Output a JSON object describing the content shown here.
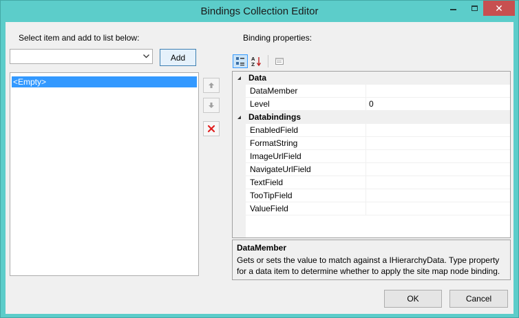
{
  "window": {
    "title": "Bindings Collection Editor",
    "close_glyph": "✕"
  },
  "left": {
    "label": "Select item and add to list below:",
    "combo_value": "",
    "add_label": "Add",
    "items": [
      "<Empty>"
    ]
  },
  "right": {
    "label": "Binding properties:"
  },
  "grid": {
    "categories": [
      {
        "name": "Data",
        "properties": [
          {
            "name": "DataMember",
            "value": ""
          },
          {
            "name": "Level",
            "value": "0"
          }
        ]
      },
      {
        "name": "Databindings",
        "properties": [
          {
            "name": "EnabledField",
            "value": ""
          },
          {
            "name": "FormatString",
            "value": ""
          },
          {
            "name": "ImageUrlField",
            "value": ""
          },
          {
            "name": "NavigateUrlField",
            "value": ""
          },
          {
            "name": "TextField",
            "value": ""
          },
          {
            "name": "TooTipField",
            "value": ""
          },
          {
            "name": "ValueField",
            "value": ""
          }
        ]
      }
    ]
  },
  "help": {
    "title": "DataMember",
    "text": "Gets or sets the value to match against a IHierarchyData. Type property for a data item to determine whether to apply the site map node binding."
  },
  "footer": {
    "ok_label": "OK",
    "cancel_label": "Cancel"
  },
  "colors": {
    "titlebar": "#5ccdca",
    "close": "#c75050",
    "selection": "#3399ff",
    "delete_icon": "#e02020"
  },
  "icons": {
    "categorized": "categorized-icon",
    "alphabetical": "alphabetical-icon",
    "property_pages": "property-pages-icon",
    "move_up": "arrow-up-icon",
    "move_down": "arrow-down-icon",
    "delete": "delete-icon"
  }
}
